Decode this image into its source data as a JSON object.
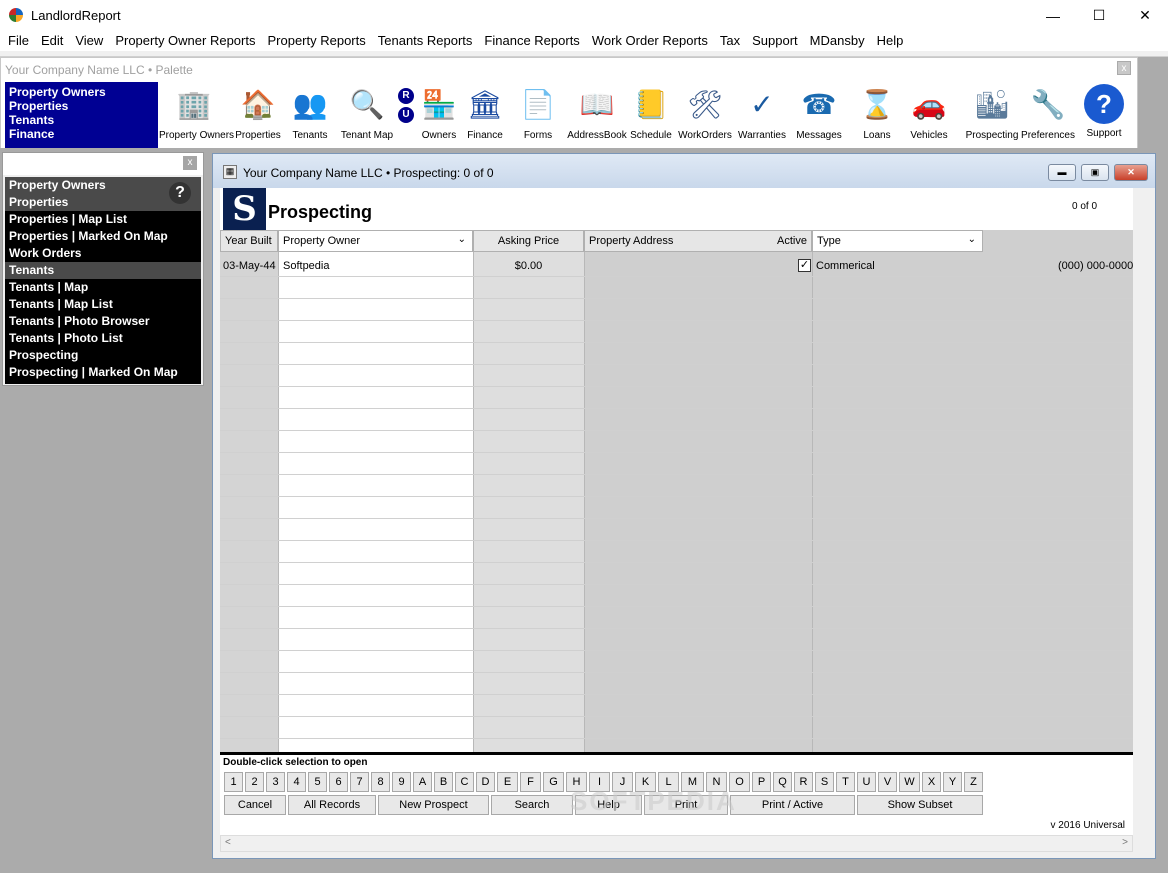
{
  "app": {
    "title": "LandlordReport"
  },
  "menu": [
    "File",
    "Edit",
    "View",
    "Property Owner Reports",
    "Property Reports",
    "Tenants Reports",
    "Finance Reports",
    "Work Order Reports",
    "Tax",
    "Support",
    "MDansby",
    "Help"
  ],
  "palette": {
    "title": "Your Company Name LLC  • Palette",
    "nav": [
      "Property Owners",
      "Properties",
      "Tenants",
      "Finance"
    ],
    "ru": [
      "R",
      "U"
    ],
    "tools": [
      {
        "label": "Property Owners",
        "icon": "building-icon"
      },
      {
        "label": "Properties",
        "icon": "house-icon"
      },
      {
        "label": "Tenants",
        "icon": "people-icon"
      },
      {
        "label": "Tenant Map",
        "icon": "magnifier-icon"
      },
      {
        "label": "Owners",
        "icon": "shop-icon"
      },
      {
        "label": "Finance",
        "icon": "bank-icon"
      },
      {
        "label": "Forms",
        "icon": "document-icon"
      },
      {
        "label": "AddressBook",
        "icon": "address-book-icon"
      },
      {
        "label": "Schedule",
        "icon": "notebook-icon"
      },
      {
        "label": "WorkOrders",
        "icon": "tools-icon"
      },
      {
        "label": "Warranties",
        "icon": "warranty-icon"
      },
      {
        "label": "Messages",
        "icon": "telephone-icon"
      },
      {
        "label": "Loans",
        "icon": "hourglass-icon"
      },
      {
        "label": "Vehicles",
        "icon": "car-icon"
      },
      {
        "label": "Prospecting",
        "icon": "tower-icon"
      },
      {
        "label": "Preferences",
        "icon": "wrench-icon"
      },
      {
        "label": "Support",
        "icon": "help-icon"
      }
    ]
  },
  "leftpanel": {
    "items": [
      {
        "label": "Property Owners",
        "grey": true
      },
      {
        "label": "Properties",
        "grey": true
      },
      {
        "label": "Properties | Map List",
        "grey": false
      },
      {
        "label": "Properties | Marked On Map",
        "grey": false
      },
      {
        "label": "Work Orders",
        "grey": false
      },
      {
        "label": "Tenants",
        "grey": true
      },
      {
        "label": "Tenants | Map",
        "grey": false
      },
      {
        "label": "Tenants | Map List",
        "grey": false
      },
      {
        "label": "Tenants | Photo Browser",
        "grey": false
      },
      {
        "label": "Tenants | Photo List",
        "grey": false
      },
      {
        "label": "Prospecting",
        "grey": false
      },
      {
        "label": "Prospecting | Marked On Map",
        "grey": false
      }
    ],
    "help": "?"
  },
  "mainwin": {
    "title": "Your Company Name LLC  •  Prospecting: 0 of 0",
    "heading": "Prospecting",
    "logo": "S",
    "counter": "0   of   0",
    "columns": {
      "year_built": "Year Built",
      "property_owner": "Property Owner",
      "asking_price": "Asking Price",
      "property_address": "Property Address",
      "active": "Active",
      "type": "Type"
    },
    "row": {
      "year_built": "03-May-44",
      "property_owner": "Softpedia",
      "asking_price": "$0.00",
      "active": "✓",
      "type": "Commerical",
      "phone": "(000) 000-0000"
    },
    "hint": "Double-click selection to open",
    "alpha": [
      "1",
      "2",
      "3",
      "4",
      "5",
      "6",
      "7",
      "8",
      "9",
      "A",
      "B",
      "C",
      "D",
      "E",
      "F",
      "G",
      "H",
      "I",
      "J",
      "K",
      "L",
      "M",
      "N",
      "O",
      "P",
      "Q",
      "R",
      "S",
      "T",
      "U",
      "V",
      "W",
      "X",
      "Y",
      "Z"
    ],
    "actions": [
      "Cancel",
      "All Records",
      "New Prospect",
      "Search",
      "Help",
      "Print",
      "Print / Active",
      "Show Subset"
    ],
    "version": "v 2016 Universal",
    "watermark": "SOFTPEDIA"
  }
}
